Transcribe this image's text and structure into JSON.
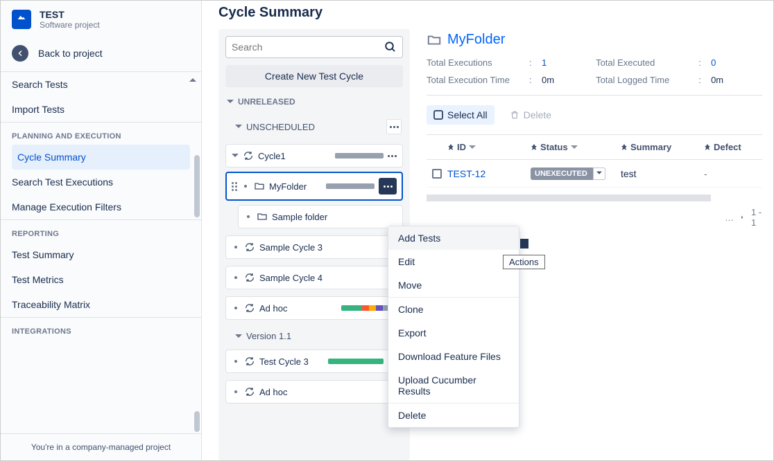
{
  "project": {
    "name": "TEST",
    "subtitle": "Software project"
  },
  "back_label": "Back to project",
  "nav": {
    "search_tests": "Search Tests",
    "import_tests": "Import Tests",
    "section_planning": "PLANNING AND EXECUTION",
    "cycle_summary": "Cycle Summary",
    "search_executions": "Search Test Executions",
    "manage_filters": "Manage Execution Filters",
    "section_reporting": "REPORTING",
    "test_summary": "Test Summary",
    "test_metrics": "Test Metrics",
    "traceability": "Traceability Matrix",
    "section_integrations": "INTEGRATIONS"
  },
  "footer": "You're in a company-managed project",
  "page_title": "Cycle Summary",
  "tree": {
    "search_placeholder": "Search",
    "create_btn": "Create New Test Cycle",
    "unreleased": "UNRELEASED",
    "unscheduled": "UNSCHEDULED",
    "cycle1": "Cycle1",
    "myfolder": "MyFolder",
    "sample_folder": "Sample folder",
    "sample_cycle3": "Sample Cycle 3",
    "sample_cycle4": "Sample Cycle 4",
    "adhoc": "Ad hoc",
    "version11": "Version 1.1",
    "test_cycle3": "Test Cycle 3",
    "adhoc2": "Ad hoc"
  },
  "detail": {
    "title": "MyFolder",
    "total_exec_label": "Total Executions",
    "total_exec_val": "1",
    "total_exec_time_label": "Total Execution Time",
    "total_exec_time_val": "0m",
    "total_executed_label": "Total Executed",
    "total_executed_val": "0",
    "total_logged_label": "Total Logged Time",
    "total_logged_val": "0m",
    "select_all": "Select All",
    "delete": "Delete",
    "col_id": "ID",
    "col_status": "Status",
    "col_summary": "Summary",
    "col_defect": "Defect",
    "row_id": "TEST-12",
    "row_status": "UNEXECUTED",
    "row_summary": "test",
    "row_defect": "-",
    "pager": "1 - 1"
  },
  "ctx": {
    "add_tests": "Add Tests",
    "edit": "Edit",
    "move": "Move",
    "clone": "Clone",
    "export": "Export",
    "download": "Download Feature Files",
    "upload": "Upload Cucumber Results",
    "delete": "Delete"
  },
  "tooltip": "Actions"
}
